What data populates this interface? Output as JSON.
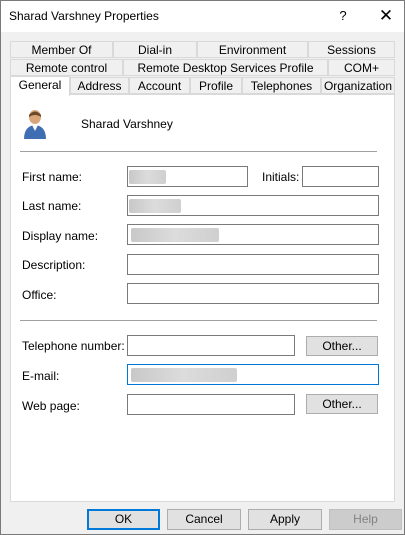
{
  "window": {
    "title": "Sharad Varshney Properties",
    "help_glyph": "?",
    "close_glyph": "✕"
  },
  "tabs": {
    "row1": [
      "Member Of",
      "Dial-in",
      "Environment",
      "Sessions"
    ],
    "row2": [
      "Remote control",
      "Remote Desktop Services Profile",
      "COM+"
    ],
    "row3": [
      "General",
      "Address",
      "Account",
      "Profile",
      "Telephones",
      "Organization"
    ],
    "active": "General"
  },
  "general": {
    "display_user": "Sharad Varshney",
    "labels": {
      "first_name": "First name:",
      "initials": "Initials:",
      "last_name": "Last name:",
      "display_name": "Display name:",
      "description": "Description:",
      "office": "Office:",
      "telephone": "Telephone number:",
      "email": "E-mail:",
      "web_page": "Web page:"
    },
    "values": {
      "first_name": "",
      "initials": "",
      "last_name": "",
      "display_name": "",
      "description": "",
      "office": "",
      "telephone": "",
      "email": "",
      "web_page": ""
    },
    "other_label": "Other..."
  },
  "footer": {
    "ok": "OK",
    "cancel": "Cancel",
    "apply": "Apply",
    "help": "Help"
  },
  "icons": {
    "user_avatar": "user-avatar-icon"
  },
  "colors": {
    "focus_border": "#0078d7",
    "panel_bg": "#ffffff",
    "dialog_bg": "#f0f0f0"
  }
}
